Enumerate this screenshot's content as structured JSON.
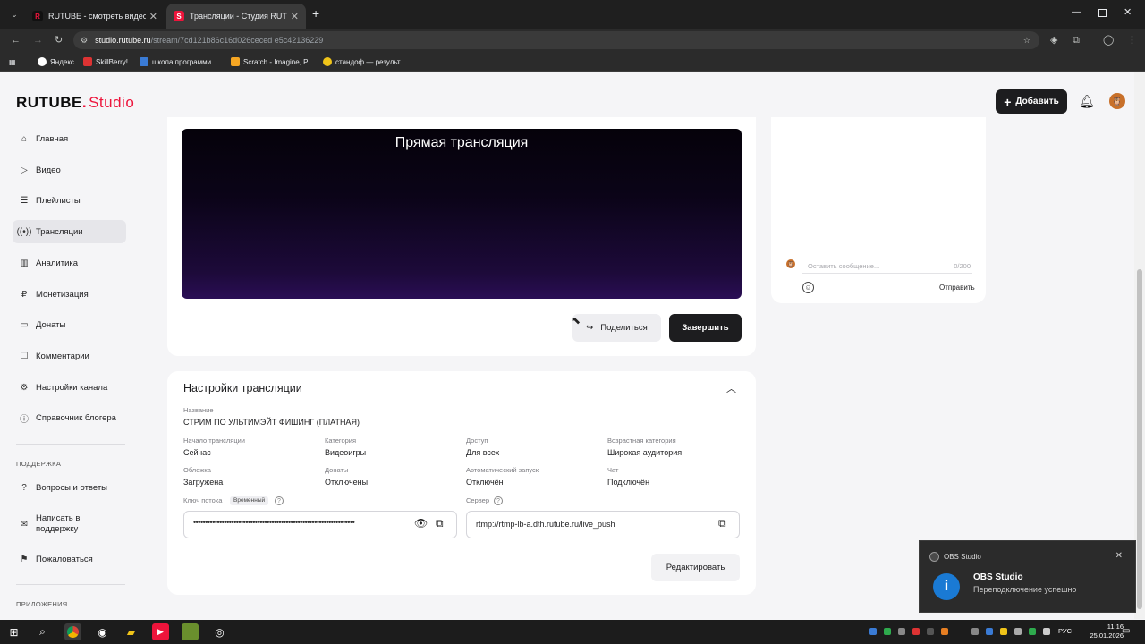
{
  "browser": {
    "tabs": [
      {
        "favicon": "R",
        "title": "RUTUBE - смотреть видео он",
        "active": false
      },
      {
        "favicon": "S",
        "title": "Трансляции - Студия RUTUBE",
        "active": true
      }
    ],
    "url_host": "studio.rutube.ru",
    "url_path": "/stream/7cd121b86c16d026ceced e5c42136229",
    "bookmarks": [
      "Яндекс",
      "SkillBerry!",
      "школа программи...",
      "Scratch - Imagine, P...",
      "стандоф — результ..."
    ]
  },
  "header": {
    "logo_main": "RUTUBE",
    "logo_sub": "Studio",
    "add_label": "Добавить"
  },
  "sidebar": {
    "items": [
      {
        "label": "Главная",
        "icon": "home-icon"
      },
      {
        "label": "Видео",
        "icon": "video-icon"
      },
      {
        "label": "Плейлисты",
        "icon": "playlist-icon"
      },
      {
        "label": "Трансляции",
        "icon": "broadcast-icon"
      },
      {
        "label": "Аналитика",
        "icon": "analytics-icon"
      },
      {
        "label": "Монетизация",
        "icon": "monetization-icon"
      },
      {
        "label": "Донаты",
        "icon": "donations-icon"
      },
      {
        "label": "Комментарии",
        "icon": "comments-icon"
      },
      {
        "label": "Настройки канала",
        "icon": "gear-icon"
      },
      {
        "label": "Справочник блогера",
        "icon": "info-icon"
      }
    ],
    "support_label": "ПОДДЕРЖКА",
    "support_items": [
      {
        "label": "Вопросы и ответы",
        "icon": "question-icon"
      },
      {
        "label": "Написать в поддержку",
        "icon": "mail-icon"
      },
      {
        "label": "Пожаловаться",
        "icon": "flag-icon"
      }
    ],
    "apps_label": "ПРИЛОЖЕНИЯ"
  },
  "player": {
    "title": "Прямая трансляция",
    "share_label": "Поделиться",
    "finish_label": "Завершить"
  },
  "chat": {
    "placeholder": "Оставить сообщение...",
    "counter": "0/200",
    "send_label": "Отправить"
  },
  "settings": {
    "title": "Настройки трансляции",
    "name_label": "Название",
    "name_value": "СТРИМ ПО УЛЬТИМЭЙТ ФИШИНГ (ПЛАТНАЯ)",
    "fields": [
      {
        "label": "Начало трансляции",
        "value": "Сейчас"
      },
      {
        "label": "Категория",
        "value": "Видеоигры"
      },
      {
        "label": "Доступ",
        "value": "Для всех"
      },
      {
        "label": "Возрастная категория",
        "value": "Широкая аудитория"
      },
      {
        "label": "Обложка",
        "value": "Загружена"
      },
      {
        "label": "Донаты",
        "value": "Отключены"
      },
      {
        "label": "Автоматический запуск",
        "value": "Отключён"
      },
      {
        "label": "Чат",
        "value": "Подключён"
      }
    ],
    "key_label": "Ключ потока",
    "key_badge": "Временный",
    "key_value": "••••••••••••••••••••••••••••••••••••••••••••••••••••••••••••••••••••",
    "server_label": "Сервер",
    "server_value": "rtmp://rtmp-lb-a.dth.rutube.ru/live_push",
    "edit_label": "Редактировать"
  },
  "toast": {
    "app": "OBS Studio",
    "title": "OBS Studio",
    "message": "Переподключение успешно"
  },
  "taskbar": {
    "lang": "РУС",
    "time": "11:16",
    "date": "25.01.2026"
  },
  "colors": {
    "accent_red": "#ed143b",
    "dark_button": "#1d1d1f",
    "notification_blue": "#1a7ad4"
  }
}
